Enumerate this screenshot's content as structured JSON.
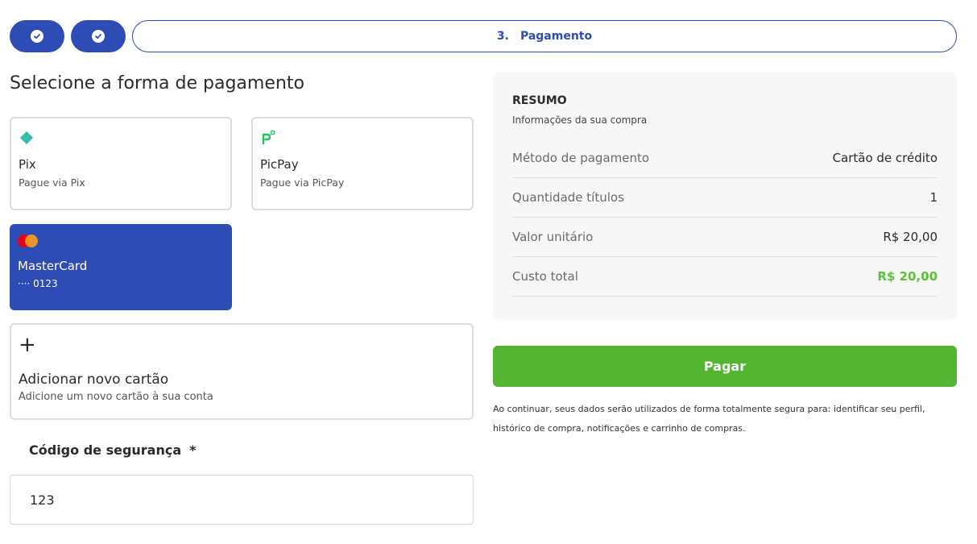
{
  "stepper": {
    "step_number": "3.",
    "step_label": "Pagamento"
  },
  "page_title": "Selecione a forma de pagamento",
  "methods": {
    "pix": {
      "name": "Pix",
      "sub": "Pague via Pix",
      "icon": "pix-icon"
    },
    "picpay": {
      "name": "PicPay",
      "sub": "Pague via PicPay",
      "icon": "picpay-icon"
    },
    "mastercard": {
      "name": "MasterCard",
      "sub": "···· 0123",
      "icon": "mastercard-icon"
    },
    "add_card": {
      "plus": "+",
      "name": "Adicionar novo cartão",
      "sub": "Adicione um novo cartão à sua conta"
    }
  },
  "security": {
    "label": "Código de segurança",
    "required": "*",
    "value": "123"
  },
  "summary": {
    "title": "RESUMO",
    "subtitle": "Informações da sua compra",
    "rows": [
      {
        "label": "Método de pagamento",
        "value": "Cartão de crédito"
      },
      {
        "label": "Quantidade títulos",
        "value": "1"
      },
      {
        "label": "Valor unitário",
        "value": "R$ 20,00"
      },
      {
        "label": "Custo total",
        "value": "R$ 20,00"
      }
    ]
  },
  "pay_button": "Pagar",
  "disclaimer": "Ao continuar, seus dados serão utilizados de forma totalmente segura para: identificar seu perfil, histórico de compra, notificações e carrinho de compras.",
  "colors": {
    "primary": "#2e4db4",
    "success": "#53b532",
    "total_green": "#5cc23a"
  }
}
